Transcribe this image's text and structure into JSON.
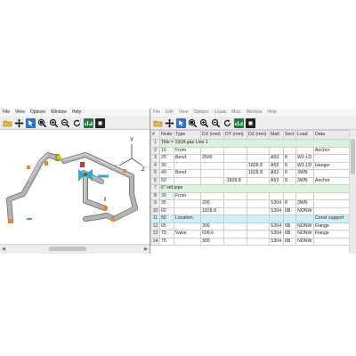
{
  "left_window": {
    "menu": [
      "File",
      "View",
      "Options",
      "Window",
      "Help"
    ],
    "toolbar_icons": [
      "open-folder-icon",
      "move-icon",
      "select-icon",
      "zoom-fit-icon",
      "zoom-in-icon",
      "zoom-out-icon",
      "rotate-icon",
      "chart-icon",
      "stop-icon"
    ],
    "axis_labels": {
      "y": "Y",
      "x": "X",
      "z": "Z"
    },
    "colors": {
      "pipe": "#b4b4b4",
      "pipe_edge": "#6e6e6e",
      "anchor": "#e58a2e",
      "flange": "#39a8d0",
      "valve": "#c0392b",
      "support_green": "#4caf50"
    }
  },
  "right_window": {
    "menu": [
      "File",
      "Edit",
      "View",
      "Options",
      "Loads",
      "Misc",
      "Window",
      "Help"
    ],
    "toolbar_icons": [
      "open-folder-icon",
      "move-icon",
      "select-icon",
      "zoom-fit-icon",
      "zoom-in-icon",
      "zoom-out-icon",
      "rotate-icon",
      "chart-icon",
      "stop-icon"
    ],
    "columns": [
      "#",
      "Node",
      "Type",
      "DX (mm)",
      "DY (mm)",
      "DZ (mm)",
      "Matl",
      "Sect",
      "Load",
      "Data"
    ],
    "rows": [
      {
        "n": "1",
        "span": "Title = 150A gas Line 1"
      },
      {
        "n": "2",
        "cells": [
          "10",
          "From",
          "",
          "",
          "",
          "",
          "",
          "",
          "Anchor"
        ]
      },
      {
        "n": "3",
        "cells": [
          "20",
          "Bend",
          "2500",
          "",
          "",
          "A53",
          "8",
          "W1-LD",
          ""
        ]
      },
      {
        "n": "4",
        "cells": [
          "30",
          "",
          "",
          "",
          "1828.8",
          "A53",
          "8",
          "W1-LD",
          "Hanger"
        ]
      },
      {
        "n": "5",
        "cells": [
          "40",
          "Bend",
          "",
          "",
          "1828.8",
          "A53",
          "8",
          "3WN",
          ""
        ]
      },
      {
        "n": "6",
        "cells": [
          "50",
          "",
          "",
          "-1828.8",
          "",
          "A53",
          "8",
          "3WN",
          "Anchor"
        ]
      },
      {
        "n": "7",
        "span": "6\" std pipe"
      },
      {
        "n": "8",
        "cells": [
          "30",
          "From",
          "",
          "",
          "",
          "",
          "",
          "",
          ""
        ]
      },
      {
        "n": "9",
        "cells": [
          "35",
          "",
          "200",
          "",
          "",
          "S304",
          "8",
          "3WN",
          ""
        ]
      },
      {
        "n": "10",
        "cells": [
          "60",
          "",
          "1828.8",
          "",
          "",
          "S304",
          "6B",
          "NONW",
          ""
        ]
      },
      {
        "n": "11",
        "loc": true,
        "cells": [
          "50",
          "Location",
          "",
          "",
          "",
          "",
          "",
          "",
          "Const support"
        ]
      },
      {
        "n": "12",
        "cells": [
          "65",
          "",
          "300",
          "",
          "",
          "S304",
          "6B",
          "NONW",
          "Flange"
        ]
      },
      {
        "n": "13",
        "cells": [
          "70",
          "Valve",
          "609.6",
          "",
          "",
          "S304",
          "6B",
          "NONW",
          "Flange"
        ]
      },
      {
        "n": "14",
        "cells": [
          "75",
          "",
          "300",
          "",
          "",
          "S304",
          "6B",
          "NONW",
          ""
        ]
      }
    ]
  }
}
